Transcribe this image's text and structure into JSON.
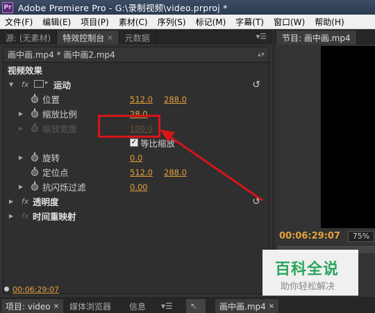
{
  "window": {
    "title": "Adobe Premiere Pro - G:\\录制视频\\video.prproj *",
    "app_icon": "Pr"
  },
  "menu": [
    "文件(F)",
    "编辑(E)",
    "项目(P)",
    "素材(C)",
    "序列(S)",
    "标记(M)",
    "字幕(T)",
    "窗口(W)",
    "帮助(H)"
  ],
  "left_tabs": [
    {
      "label": "源: (无素材)"
    },
    {
      "label": "特效控制台",
      "close": "×"
    },
    {
      "label": "元数据"
    }
  ],
  "clip_header": "画中画.mp4 * 画中画2.mp4",
  "effects": {
    "section_label": "视频效果",
    "motion": {
      "label": "运动",
      "fx": "fx"
    },
    "position": {
      "label": "位置",
      "x": "512.0",
      "y": "288.0"
    },
    "scale": {
      "label": "缩放比例",
      "value": "28.0"
    },
    "scale_width": {
      "label": "缩放宽度",
      "value": "100.0"
    },
    "uniform_scale": {
      "label": "等比缩放",
      "checked": "✓"
    },
    "rotation": {
      "label": "旋转",
      "value": "0.0"
    },
    "anchor": {
      "label": "定位点",
      "x": "512.0",
      "y": "288.0"
    },
    "antiflicker": {
      "label": "抗闪烁过滤",
      "value": "0.00"
    },
    "opacity": {
      "label": "透明度",
      "fx": "fx"
    },
    "time_remap": {
      "label": "时间重映射",
      "fx": "fx"
    },
    "reset_icon": "↺"
  },
  "left_timecode": "00:06:29:07",
  "right_panel": {
    "tab": "节目: 画中画.mp4",
    "timecode": "00:06:29:07",
    "zoom": "75%"
  },
  "bottom_tabs": [
    {
      "label": "项目: video",
      "close": "×"
    },
    {
      "label": "媒体浏览器"
    },
    {
      "label": "信息"
    },
    {
      "label": "画中画.mp4",
      "close": "×"
    }
  ],
  "watermark": {
    "title": "百科全说",
    "subtitle": "助你轻松解决"
  },
  "colors": {
    "value_orange": "#e6a23c",
    "annotation_red": "#d8141a",
    "watermark_green": "#2aa55a"
  }
}
